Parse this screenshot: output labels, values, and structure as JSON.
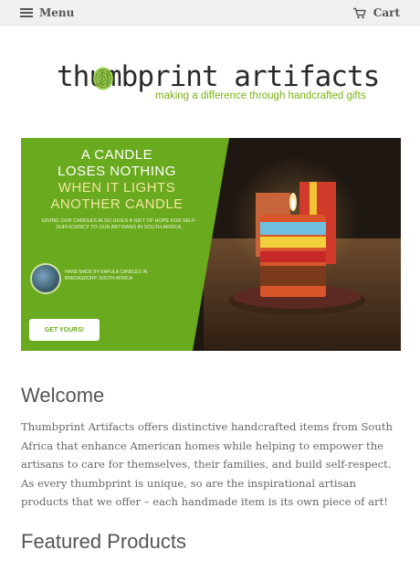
{
  "header": {
    "menu_label": "Menu",
    "cart_label": "Cart"
  },
  "logo": {
    "name": "thumbprint artifacts",
    "tagline": "making a difference through handcrafted gifts"
  },
  "banner": {
    "headline_1": "A CANDLE",
    "headline_2": "LOSES NOTHING",
    "headline_3": "WHEN IT LIGHTS",
    "headline_4": "ANOTHER CANDLE",
    "subtext": "GIVING OUR CANDLES ALSO GIVES A GIFT OF HOPE FOR SELF-SUFFICIENCY TO OUR ARTISANS IN SOUTH AFRICA.",
    "made_by": "HAND MADE BY KAPULA CANDLES IN BREDASDORP, SOUTH AFRICA",
    "cta": "GET YOURS!",
    "green": "#6aaa1e"
  },
  "welcome": {
    "heading": "Welcome",
    "body": "Thumbprint Artifacts offers distinctive handcrafted items from South Africa that enhance American homes while helping to empower the artisans to care for themselves, their families, and build self-respect. As every thumbprint is unique, so are the inspirational artisan products that we offer – each handmade item is its own piece of art!"
  },
  "featured": {
    "heading": "Featured Products"
  }
}
